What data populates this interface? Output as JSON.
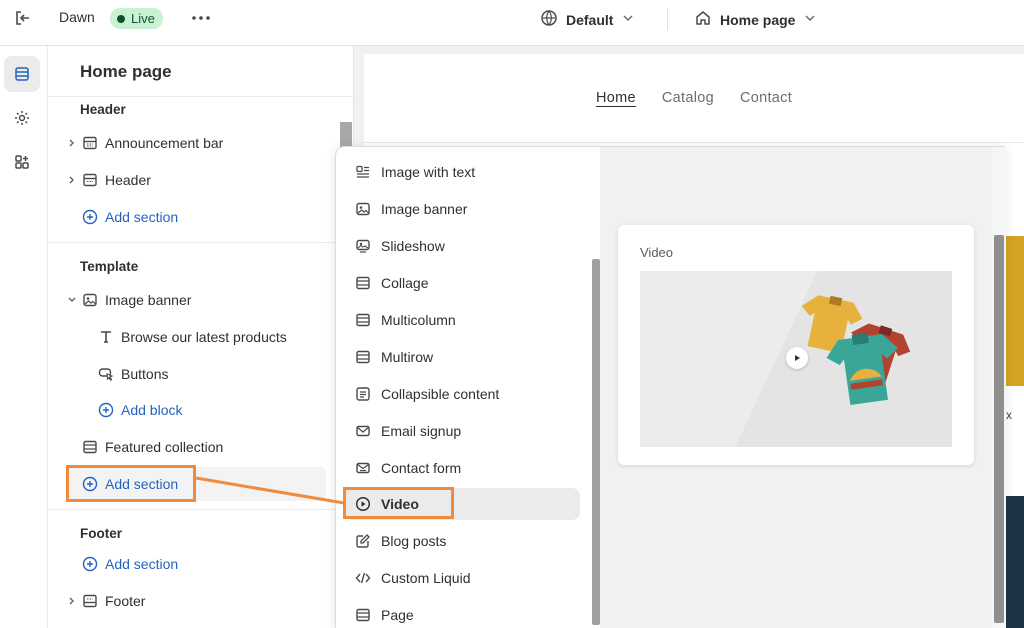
{
  "topbar": {
    "theme_name": "Dawn",
    "live_badge": "Live",
    "view_selector": "Default",
    "page_selector": "Home page"
  },
  "sidebar": {
    "title": "Home page",
    "header_group": "Header",
    "header_items": [
      {
        "label": "Announcement bar",
        "icon": "announcement-bar-icon"
      },
      {
        "label": "Header",
        "icon": "header-layout-icon"
      }
    ],
    "header_add": "Add section",
    "template_group": "Template",
    "image_banner": "Image banner",
    "blocks": [
      "Browse our latest products",
      "Buttons"
    ],
    "add_block": "Add block",
    "featured_collection": "Featured collection",
    "template_add": "Add section",
    "footer_group": "Footer",
    "footer_add": "Add section",
    "footer_item": "Footer"
  },
  "preview": {
    "nav": [
      "Home",
      "Catalog",
      "Contact"
    ]
  },
  "picker": {
    "items": [
      {
        "label": "Image with text",
        "icon": "image-with-text-icon"
      },
      {
        "label": "Image banner",
        "icon": "image-icon"
      },
      {
        "label": "Slideshow",
        "icon": "slideshow-icon"
      },
      {
        "label": "Collage",
        "icon": "layout-icon"
      },
      {
        "label": "Multicolumn",
        "icon": "layout-icon"
      },
      {
        "label": "Multirow",
        "icon": "layout-icon"
      },
      {
        "label": "Collapsible content",
        "icon": "list-icon"
      },
      {
        "label": "Email signup",
        "icon": "mail-icon"
      },
      {
        "label": "Contact form",
        "icon": "form-icon"
      },
      {
        "label": "Video",
        "icon": "play-circle-icon",
        "selected": true
      },
      {
        "label": "Blog posts",
        "icon": "edit-icon"
      },
      {
        "label": "Custom Liquid",
        "icon": "code-icon"
      },
      {
        "label": "Page",
        "icon": "layout-icon"
      }
    ],
    "preview_label": "Video"
  },
  "colors": {
    "accent": "#2463bc",
    "callout": "#f08a3c",
    "live_bg": "#c9f2d3"
  }
}
